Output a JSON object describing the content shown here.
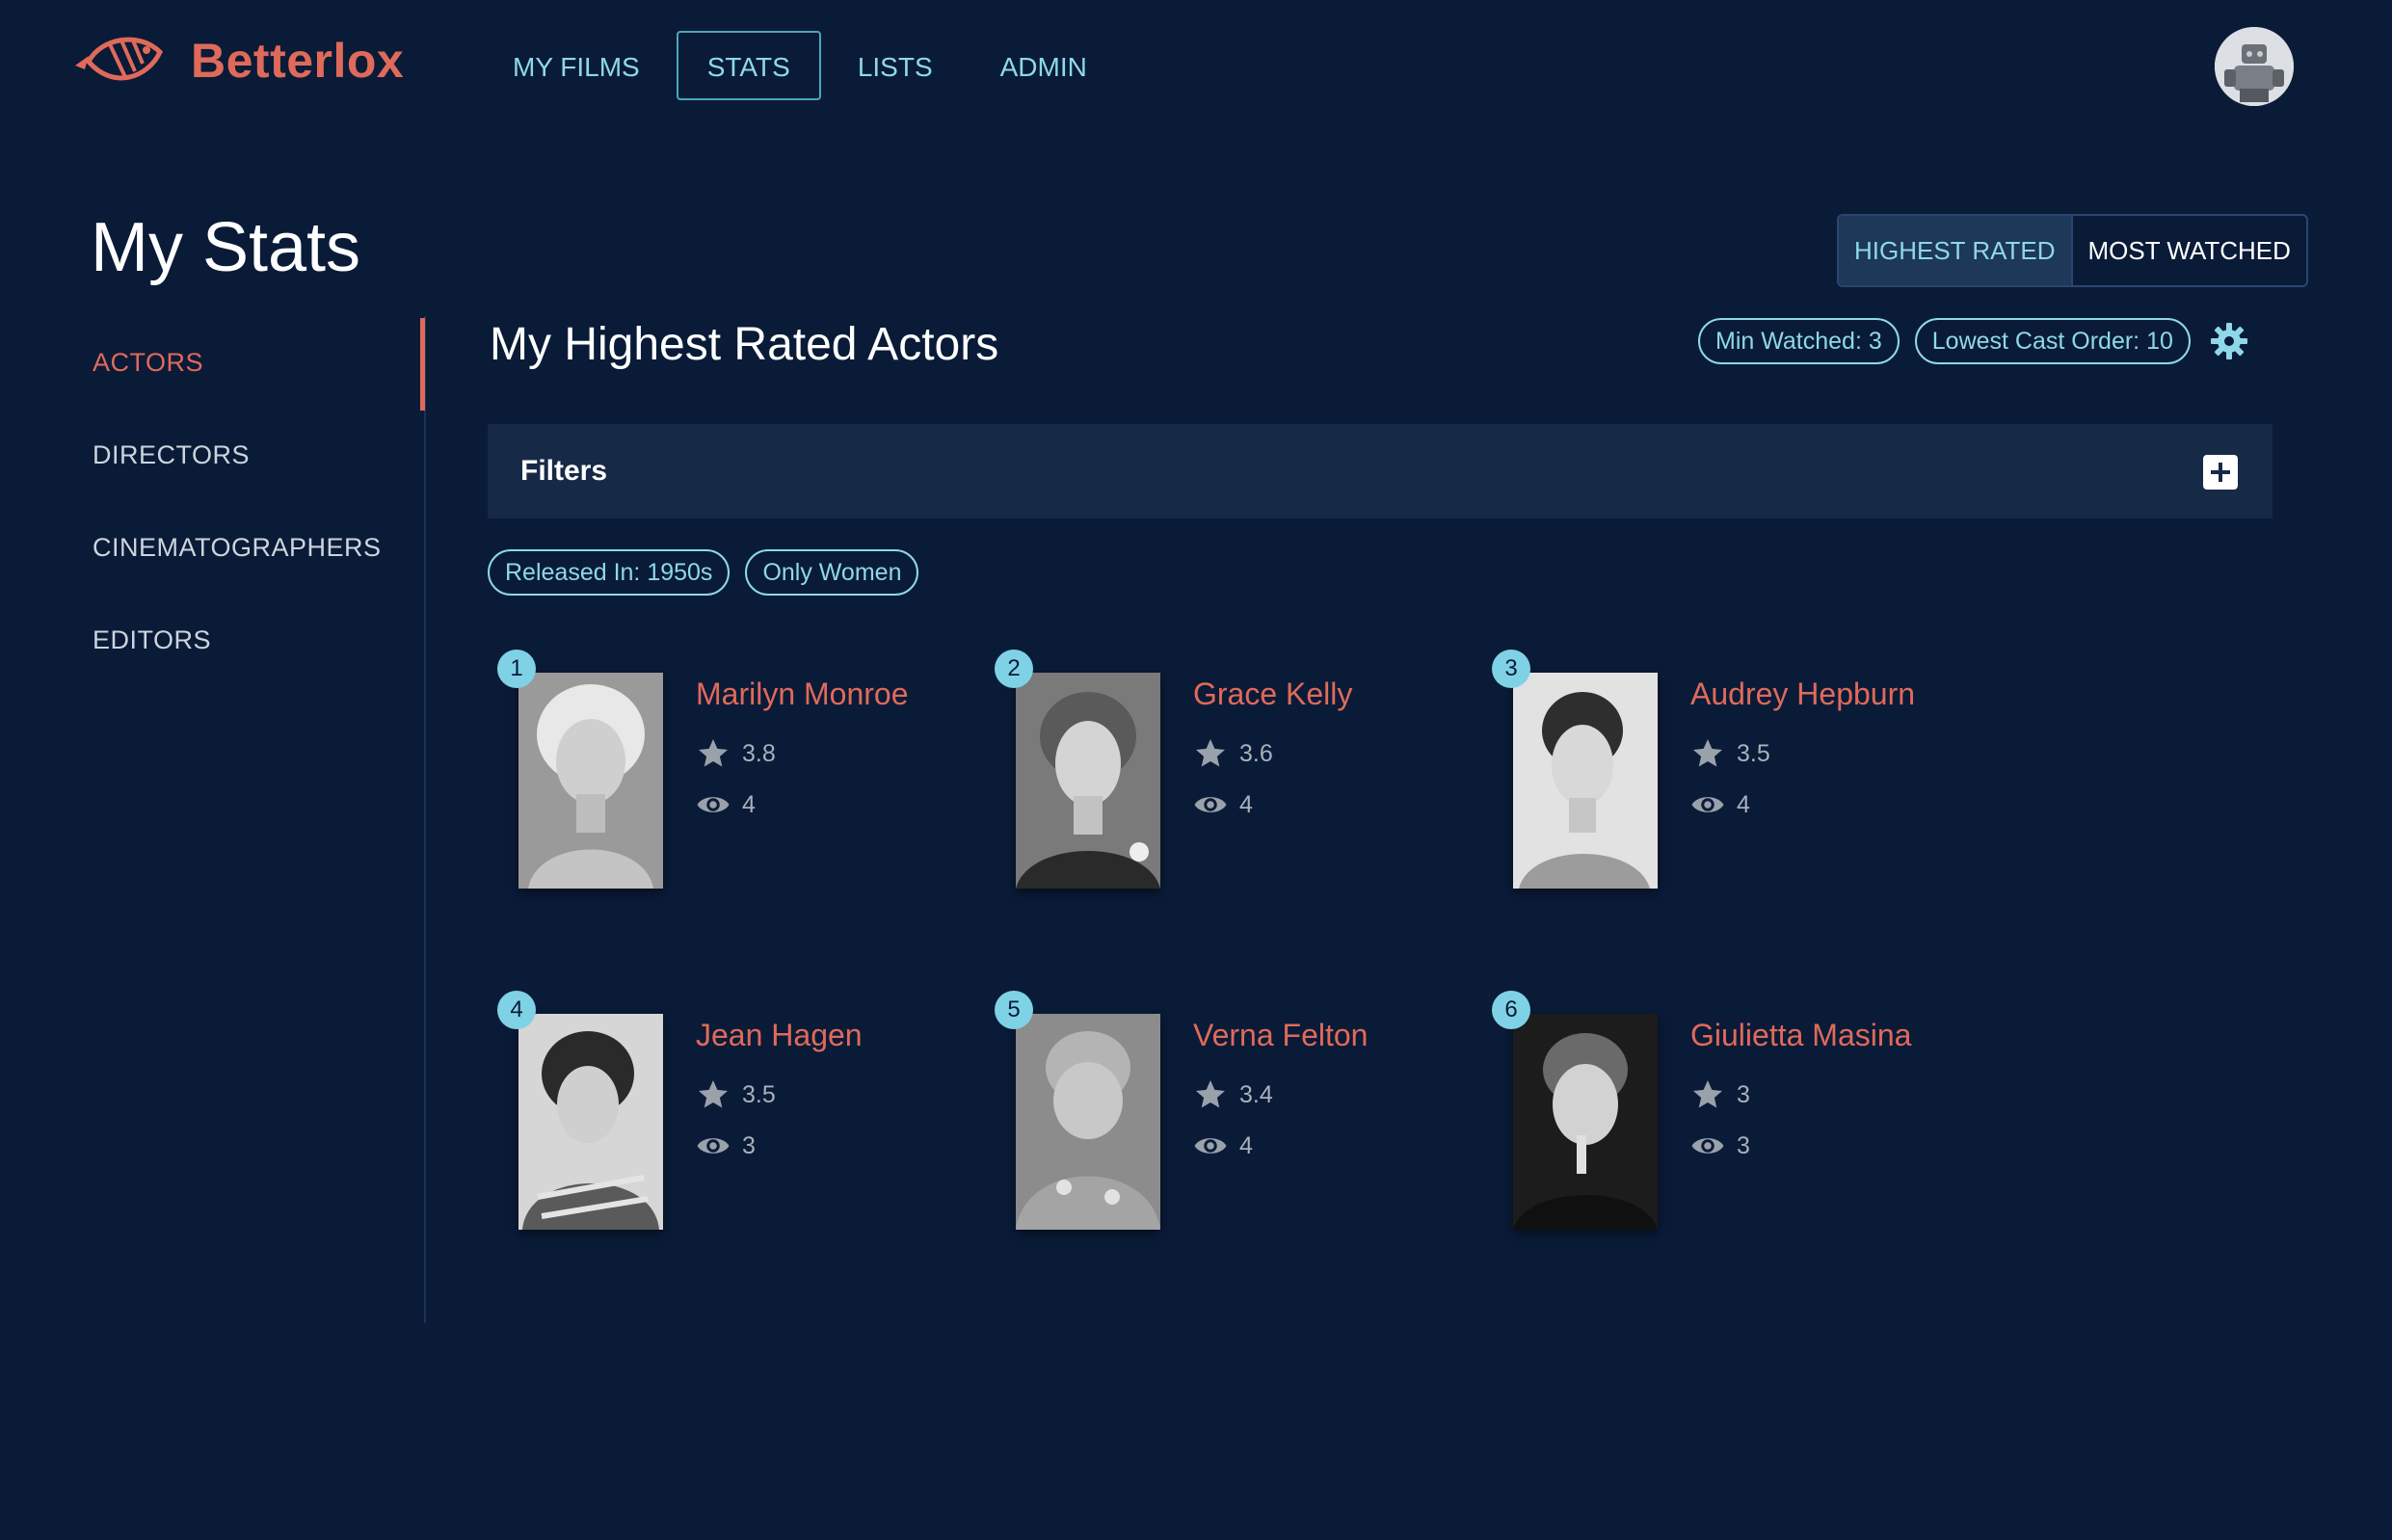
{
  "app": {
    "name": "Betterlox",
    "nav": [
      "MY FILMS",
      "STATS",
      "LISTS",
      "ADMIN"
    ],
    "active_nav": "STATS"
  },
  "page": {
    "title": "My Stats",
    "sidebar": [
      "ACTORS",
      "DIRECTORS",
      "CINEMATOGRAPHERS",
      "EDITORS"
    ],
    "active_sidebar": "ACTORS"
  },
  "sort": {
    "options": [
      "HIGHEST RATED",
      "MOST WATCHED"
    ],
    "active": "HIGHEST RATED"
  },
  "section": {
    "title": "My Highest Rated Actors",
    "settings_chips": [
      "Min Watched: 3",
      "Lowest Cast Order: 10"
    ]
  },
  "filters": {
    "label": "Filters",
    "active_chips": [
      "Released In: 1950s",
      "Only Women"
    ]
  },
  "actors": [
    {
      "rank": "1",
      "name": "Marilyn Monroe",
      "rating": "3.8",
      "watched": "4"
    },
    {
      "rank": "2",
      "name": "Grace Kelly",
      "rating": "3.6",
      "watched": "4"
    },
    {
      "rank": "3",
      "name": "Audrey Hepburn",
      "rating": "3.5",
      "watched": "4"
    },
    {
      "rank": "4",
      "name": "Jean Hagen",
      "rating": "3.5",
      "watched": "3"
    },
    {
      "rank": "5",
      "name": "Verna Felton",
      "rating": "3.4",
      "watched": "4"
    },
    {
      "rank": "6",
      "name": "Giulietta Masina",
      "rating": "3",
      "watched": "3"
    }
  ],
  "colors": {
    "background": "#0a1b38",
    "accent_coral": "#e06a5a",
    "accent_cyan": "#8ed8ea",
    "panel": "#162947"
  },
  "icons": {
    "logo": "fish-logo-icon",
    "settings": "gear-icon",
    "filters_expand": "plus-icon",
    "rating": "star-icon",
    "watched": "eye-icon"
  }
}
